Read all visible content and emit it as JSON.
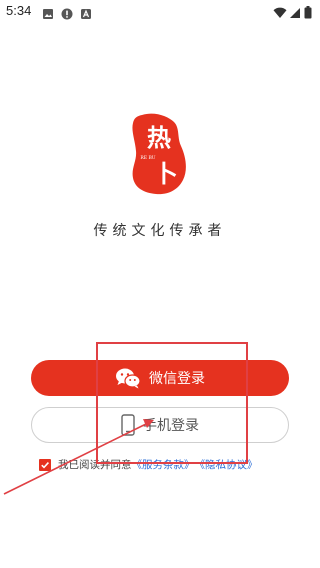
{
  "status_bar": {
    "time": "5:34"
  },
  "app": {
    "logo_main_char_1": "热",
    "logo_main_char_2": "卜",
    "logo_sub": "RE BU",
    "slogan": "传统文化传承者"
  },
  "login": {
    "wechat_label": "微信登录",
    "phone_label": "手机登录"
  },
  "agreement": {
    "prefix": "我已阅读并同意",
    "service_link": "《服务条款》",
    "privacy_link": "《隐私协议》",
    "checked": true
  },
  "colors": {
    "brand_red": "#e5321f",
    "link_blue": "#2f6fd6",
    "annotation_red": "#e04044"
  }
}
